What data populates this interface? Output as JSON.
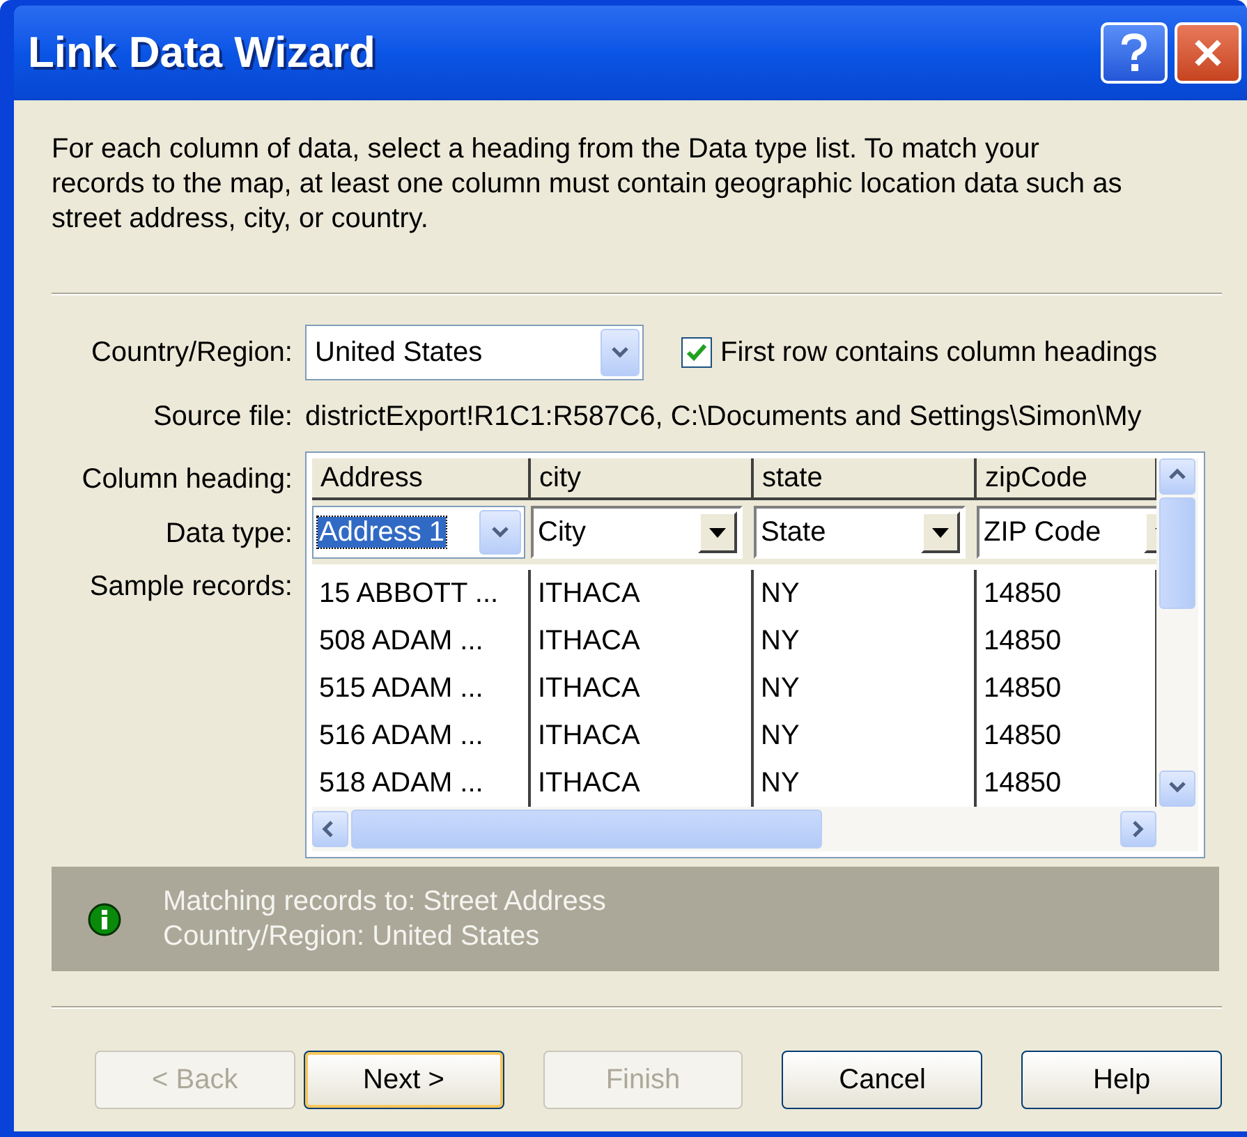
{
  "window": {
    "title": "Link Data Wizard"
  },
  "intro": "For each column of data, select a heading from the Data type list. To match your records to the map, at least one column must contain geographic location data such as street address, city, or country.",
  "country": {
    "label": "Country/Region:",
    "value": "United States"
  },
  "first_row_headings": {
    "label": "First row contains column headings",
    "checked": true
  },
  "source_file": {
    "label": "Source file:",
    "value": "districtExport!R1C1:R587C6, C:\\Documents and Settings\\Simon\\My"
  },
  "grid": {
    "labels": [
      "Column heading:",
      "Data type:",
      "Sample records:"
    ],
    "columns": [
      {
        "heading": "Address",
        "data_type": "Address 1",
        "focused": true
      },
      {
        "heading": "city",
        "data_type": "City",
        "focused": false
      },
      {
        "heading": "state",
        "data_type": "State",
        "focused": false
      },
      {
        "heading": "zipCode",
        "data_type": "ZIP Code",
        "focused": false
      }
    ],
    "rows": [
      [
        "15 ABBOTT ...",
        "ITHACA",
        "NY",
        "14850"
      ],
      [
        "508 ADAM ...",
        "ITHACA",
        "NY",
        "14850"
      ],
      [
        "515 ADAM ...",
        "ITHACA",
        "NY",
        "14850"
      ],
      [
        "516 ADAM ...",
        "ITHACA",
        "NY",
        "14850"
      ],
      [
        "518 ADAM ...",
        "ITHACA",
        "NY",
        "14850"
      ]
    ]
  },
  "info": [
    "Matching records to: Street Address",
    "Country/Region: United States"
  ],
  "buttons": [
    {
      "label": "< Back",
      "disabled": true,
      "default": false
    },
    {
      "label": "Next >",
      "disabled": false,
      "default": true
    },
    {
      "label": "Finish",
      "disabled": true,
      "default": false
    },
    {
      "label": "Cancel",
      "disabled": false,
      "default": false
    },
    {
      "label": "Help",
      "disabled": false,
      "default": false
    }
  ]
}
